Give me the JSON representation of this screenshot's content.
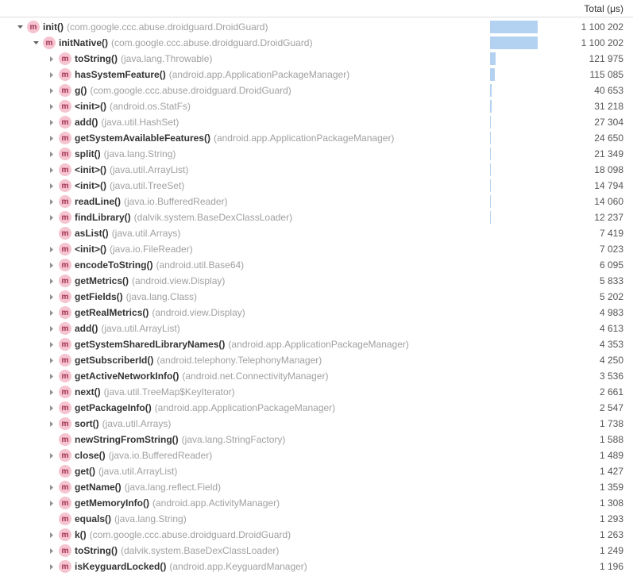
{
  "header": {
    "total_label": "Total (μs)"
  },
  "max_total": 1100202,
  "rows": [
    {
      "indent": 0,
      "expander": "open",
      "method": "init()",
      "pkg": "(com.google.ccc.abuse.droidguard.DroidGuard)",
      "total": "1 100 202",
      "bar": 1.0
    },
    {
      "indent": 1,
      "expander": "open",
      "method": "initNative()",
      "pkg": "(com.google.ccc.abuse.droidguard.DroidGuard)",
      "total": "1 100 202",
      "bar": 1.0
    },
    {
      "indent": 2,
      "expander": "closed",
      "method": "toString()",
      "pkg": "(java.lang.Throwable)",
      "total": "121 975",
      "bar": 0.1108
    },
    {
      "indent": 2,
      "expander": "closed",
      "method": "hasSystemFeature()",
      "pkg": "(android.app.ApplicationPackageManager)",
      "total": "115 085",
      "bar": 0.1046
    },
    {
      "indent": 2,
      "expander": "closed",
      "method": "g()",
      "pkg": "(com.google.ccc.abuse.droidguard.DroidGuard)",
      "total": "40 653",
      "bar": 0.037
    },
    {
      "indent": 2,
      "expander": "closed",
      "method": "<init>()",
      "pkg": "(android.os.StatFs)",
      "total": "31 218",
      "bar": 0.0284
    },
    {
      "indent": 2,
      "expander": "closed",
      "method": "add()",
      "pkg": "(java.util.HashSet)",
      "total": "27 304",
      "bar": 0.0248
    },
    {
      "indent": 2,
      "expander": "closed",
      "method": "getSystemAvailableFeatures()",
      "pkg": "(android.app.ApplicationPackageManager)",
      "total": "24 650",
      "bar": 0.0224
    },
    {
      "indent": 2,
      "expander": "closed",
      "method": "split()",
      "pkg": "(java.lang.String)",
      "total": "21 349",
      "bar": 0.0194
    },
    {
      "indent": 2,
      "expander": "closed",
      "method": "<init>()",
      "pkg": "(java.util.ArrayList)",
      "total": "18 098",
      "bar": 0.0165
    },
    {
      "indent": 2,
      "expander": "closed",
      "method": "<init>()",
      "pkg": "(java.util.TreeSet)",
      "total": "14 794",
      "bar": 0.0134
    },
    {
      "indent": 2,
      "expander": "closed",
      "method": "readLine()",
      "pkg": "(java.io.BufferedReader)",
      "total": "14 060",
      "bar": 0.0128
    },
    {
      "indent": 2,
      "expander": "closed",
      "method": "findLibrary()",
      "pkg": "(dalvik.system.BaseDexClassLoader)",
      "total": "12 237",
      "bar": 0.0111
    },
    {
      "indent": 2,
      "expander": "none",
      "method": "asList()",
      "pkg": "(java.util.Arrays)",
      "total": "7 419",
      "bar": 0.0067
    },
    {
      "indent": 2,
      "expander": "closed",
      "method": "<init>()",
      "pkg": "(java.io.FileReader)",
      "total": "7 023",
      "bar": 0.0064
    },
    {
      "indent": 2,
      "expander": "closed",
      "method": "encodeToString()",
      "pkg": "(android.util.Base64)",
      "total": "6 095",
      "bar": 0.0055
    },
    {
      "indent": 2,
      "expander": "closed",
      "method": "getMetrics()",
      "pkg": "(android.view.Display)",
      "total": "5 833",
      "bar": 0.0053
    },
    {
      "indent": 2,
      "expander": "closed",
      "method": "getFields()",
      "pkg": "(java.lang.Class)",
      "total": "5 202",
      "bar": 0.0047
    },
    {
      "indent": 2,
      "expander": "closed",
      "method": "getRealMetrics()",
      "pkg": "(android.view.Display)",
      "total": "4 983",
      "bar": 0.0045
    },
    {
      "indent": 2,
      "expander": "closed",
      "method": "add()",
      "pkg": "(java.util.ArrayList)",
      "total": "4 613",
      "bar": 0.0042
    },
    {
      "indent": 2,
      "expander": "closed",
      "method": "getSystemSharedLibraryNames()",
      "pkg": "(android.app.ApplicationPackageManager)",
      "total": "4 353",
      "bar": 0.004
    },
    {
      "indent": 2,
      "expander": "closed",
      "method": "getSubscriberId()",
      "pkg": "(android.telephony.TelephonyManager)",
      "total": "4 250",
      "bar": 0.0039
    },
    {
      "indent": 2,
      "expander": "closed",
      "method": "getActiveNetworkInfo()",
      "pkg": "(android.net.ConnectivityManager)",
      "total": "3 536",
      "bar": 0.0032
    },
    {
      "indent": 2,
      "expander": "closed",
      "method": "next()",
      "pkg": "(java.util.TreeMap$KeyIterator)",
      "total": "2 661",
      "bar": 0.0024
    },
    {
      "indent": 2,
      "expander": "closed",
      "method": "getPackageInfo()",
      "pkg": "(android.app.ApplicationPackageManager)",
      "total": "2 547",
      "bar": 0.0023
    },
    {
      "indent": 2,
      "expander": "closed",
      "method": "sort()",
      "pkg": "(java.util.Arrays)",
      "total": "1 738",
      "bar": 0.0016
    },
    {
      "indent": 2,
      "expander": "none",
      "method": "newStringFromString()",
      "pkg": "(java.lang.StringFactory)",
      "total": "1 588",
      "bar": 0.0014
    },
    {
      "indent": 2,
      "expander": "closed",
      "method": "close()",
      "pkg": "(java.io.BufferedReader)",
      "total": "1 489",
      "bar": 0.0014
    },
    {
      "indent": 2,
      "expander": "none",
      "method": "get()",
      "pkg": "(java.util.ArrayList)",
      "total": "1 427",
      "bar": 0.0013
    },
    {
      "indent": 2,
      "expander": "closed",
      "method": "getName()",
      "pkg": "(java.lang.reflect.Field)",
      "total": "1 359",
      "bar": 0.0012
    },
    {
      "indent": 2,
      "expander": "closed",
      "method": "getMemoryInfo()",
      "pkg": "(android.app.ActivityManager)",
      "total": "1 308",
      "bar": 0.0012
    },
    {
      "indent": 2,
      "expander": "none",
      "method": "equals()",
      "pkg": "(java.lang.String)",
      "total": "1 293",
      "bar": 0.0012
    },
    {
      "indent": 2,
      "expander": "closed",
      "method": "k()",
      "pkg": "(com.google.ccc.abuse.droidguard.DroidGuard)",
      "total": "1 263",
      "bar": 0.0011
    },
    {
      "indent": 2,
      "expander": "closed",
      "method": "toString()",
      "pkg": "(dalvik.system.BaseDexClassLoader)",
      "total": "1 249",
      "bar": 0.0011
    },
    {
      "indent": 2,
      "expander": "closed",
      "method": "isKeyguardLocked()",
      "pkg": "(android.app.KeyguardManager)",
      "total": "1 196",
      "bar": 0.0011
    }
  ]
}
